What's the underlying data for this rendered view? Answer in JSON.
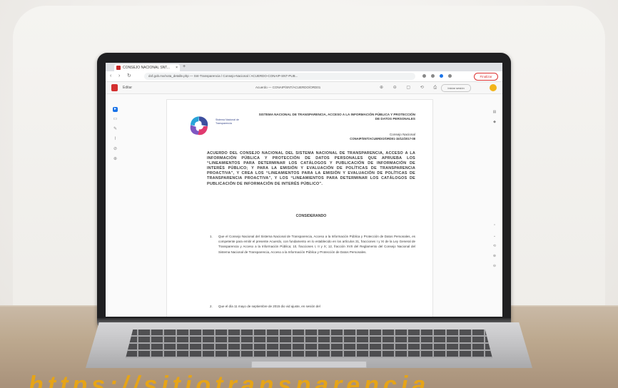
{
  "browser": {
    "tab_title": "CONSEJO NACIONAL SNT...",
    "tab_close": "×",
    "new_tab": "+",
    "url": "dof.gob.mx/nota_detalle.php — Snt-Transparencia / Consejo-Nacional / ACUERDO-CONAIP-SNT-PUB...",
    "action_button": "Finalizar",
    "nav_back": "‹",
    "nav_forward": "›",
    "nav_reload": "↻"
  },
  "pdf_toolbar": {
    "menu_label": "Editar",
    "file_title": "Acuerdo — CONAIP/SNT/ACUERDO/ORD01",
    "tools": "⊕ ⊖ ▢ ⟲ ⎙",
    "right_button": "Iniciar sesión"
  },
  "document": {
    "org_name": "Sistema Nacional de Transparencia",
    "header": "SISTEMA NACIONAL DE TRANSPARENCIA, ACCESO A LA INFORMACIÓN PÚBLICA Y PROTECCIÓN DE DATOS PERSONALES",
    "consejo": "Consejo Nacional",
    "acuerdo_id": "CONAIP/SNT/ACUERDO/ORD01-15/12/2017-08",
    "title": "ACUERDO DEL CONSEJO NACIONAL DEL SISTEMA NACIONAL DE TRANSPARENCIA, ACCESO A LA INFORMACIÓN PÚBLICA Y PROTECCIÓN DE DATOS PERSONALES QUE APRUEBA LOS “LINEAMIENTOS PARA DETERMINAR LOS CATÁLOGOS Y PUBLICACIÓN DE INFORMACIÓN DE INTERÉS PÚBLICO; Y PARA LA EMISIÓN Y EVALUACIÓN DE POLÍTICAS DE TRANSPARENCIA PROACTIVA”, Y CREA LOS “LINEAMIENTOS PARA LA EMISIÓN Y EVALUACIÓN DE POLÍTICAS DE TRANSPARENCIA PROACTIVA”, Y LOS “LINEAMIENTOS PARA DETERMINAR LOS CATÁLOGOS DE PUBLICACIÓN DE INFORMACIÓN DE INTERÉS PÚBLICO”.",
    "section": "CONSIDERANDO",
    "item1_num": "1.",
    "item1": "Que el Consejo Nacional del Sistema Nacional de Transparencia, Acceso a la Información Pública y Protección de Datos Personales, es competente para emitir el presente Acuerdo, con fundamento en lo establecido en los artículos 31, fracciones I y XI de la Ley General de Transparencia y Acceso a la Información Pública; 10, fracciones I, II y X; 12, fracción XVII del Reglamento del Consejo Nacional del Sistema Nacional de Transparencia, Acceso a la Información Pública y Protección de Datos Personales.",
    "item2_num": "2.",
    "item2": "Que el día 11 mayo de septiembre de 2015 dio vid ajuste, en sesión del"
  },
  "footer_text": "https://sitiotransparencia"
}
